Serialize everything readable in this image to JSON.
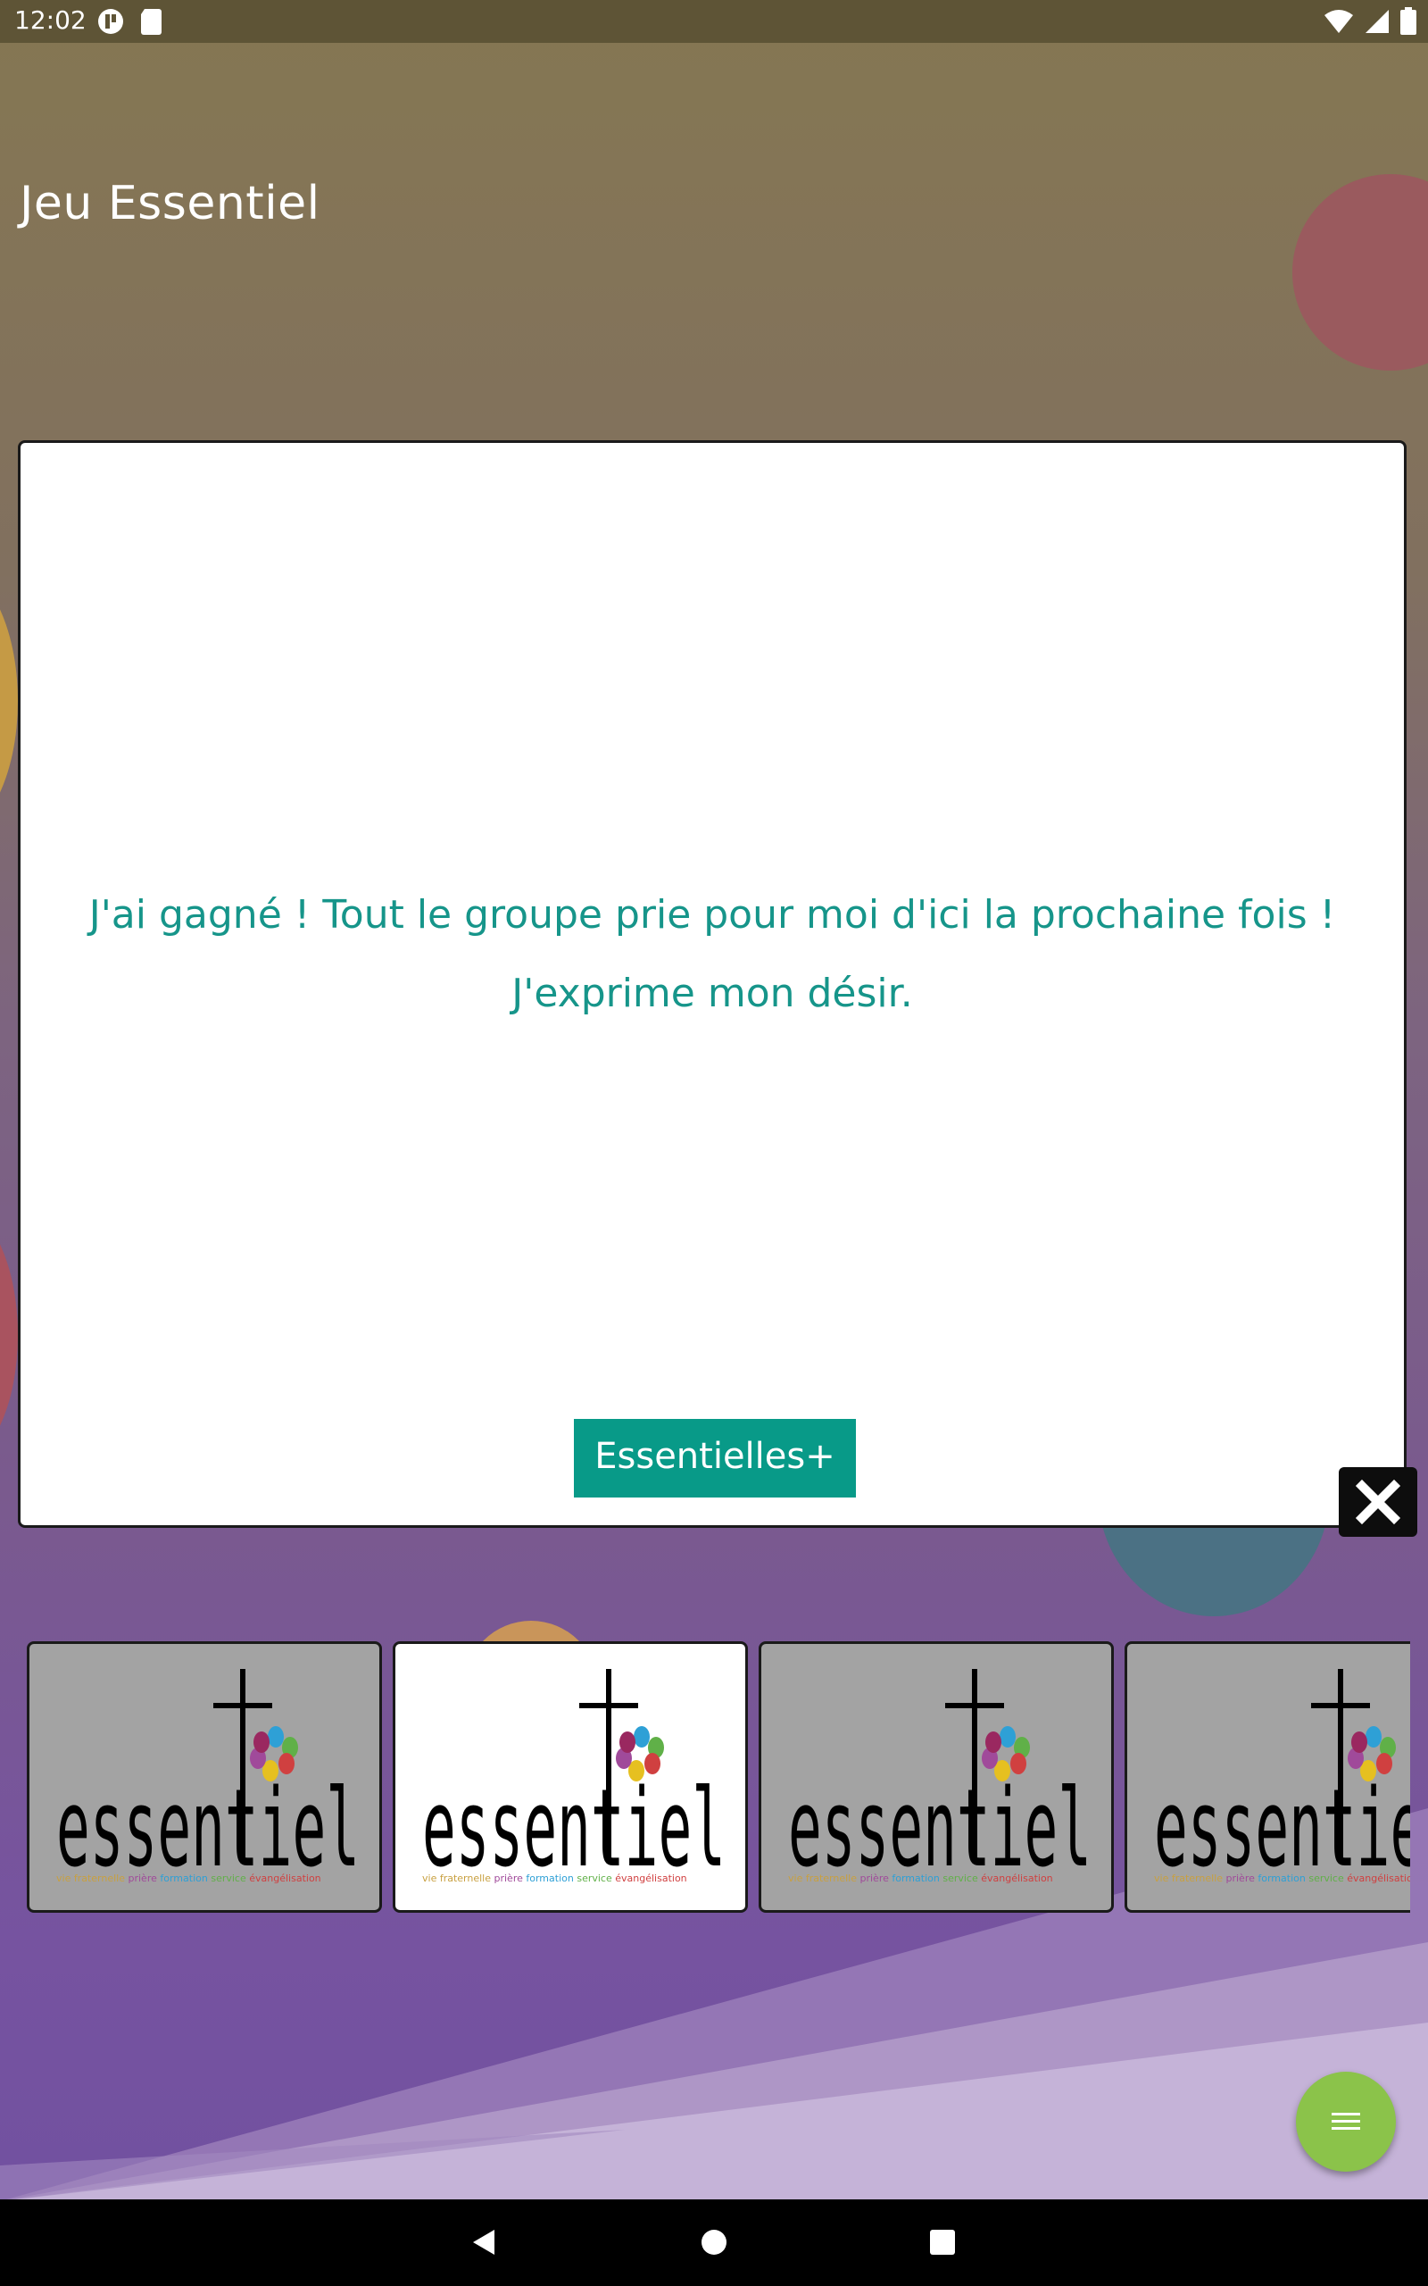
{
  "status_bar": {
    "time": "12:02",
    "left_icons": [
      "notification-app-icon",
      "sd-card-icon"
    ],
    "right_icons": [
      "wifi-icon",
      "signal-icon",
      "battery-icon"
    ]
  },
  "app": {
    "title": "Jeu Essentiel"
  },
  "card": {
    "message_line1": "J'ai gagné ! Tout le groupe prie pour moi d'ici la prochaine fois !",
    "message_line2": "J'exprime mon désir.",
    "button_label": "Essentielles+",
    "close_icon": "close-icon"
  },
  "carousel": {
    "logo_word": "essentiel",
    "tagline": [
      "vie fraternelle",
      "prière",
      "formation",
      "service",
      "évangélisation"
    ],
    "tiles": [
      {
        "selected": false
      },
      {
        "selected": true
      },
      {
        "selected": false
      },
      {
        "selected": false
      }
    ]
  },
  "fab": {
    "icon": "menu-icon"
  },
  "nav": {
    "icons": [
      "back-icon",
      "home-icon",
      "recents-icon"
    ]
  },
  "colors": {
    "accent": "#089a88",
    "fab": "#8bc34a",
    "message_text": "#16958a",
    "status_bar": "#5e5436"
  }
}
